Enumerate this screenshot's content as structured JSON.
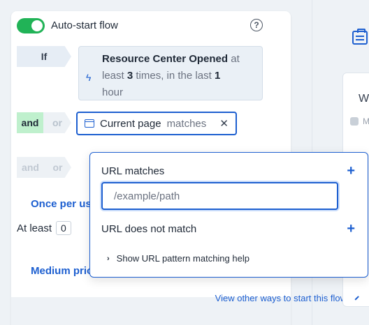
{
  "flow": {
    "toggle_label": "Auto-start flow",
    "toggle_on": true,
    "if_label": "If",
    "trigger": {
      "event": "Resource Center Opened",
      "at": "at",
      "least": "least",
      "count": "3",
      "times_in_last": "times, in the last",
      "period_value": "1",
      "period_unit": "hour"
    },
    "and_label": "and",
    "or_label": "or",
    "condition": {
      "subject": "Current page",
      "operator": "matches"
    },
    "frequency_link": "Once per us",
    "at_least_label": "At least",
    "at_least_value": "0",
    "priority_link": "Medium prio",
    "footer_link": "View other ways to start this flow"
  },
  "dropdown": {
    "url_matches_label": "URL matches",
    "url_placeholder": "/example/path",
    "url_not_match_label": "URL does not match",
    "help_label": "Show URL pattern matching help",
    "add_symbol": "+"
  },
  "right_card": {
    "title_fragment": "W",
    "meta_fragment": "M"
  },
  "colors": {
    "accent": "#1d5fd0",
    "toggle_on": "#21b357",
    "and_active": "#bff0cd"
  }
}
